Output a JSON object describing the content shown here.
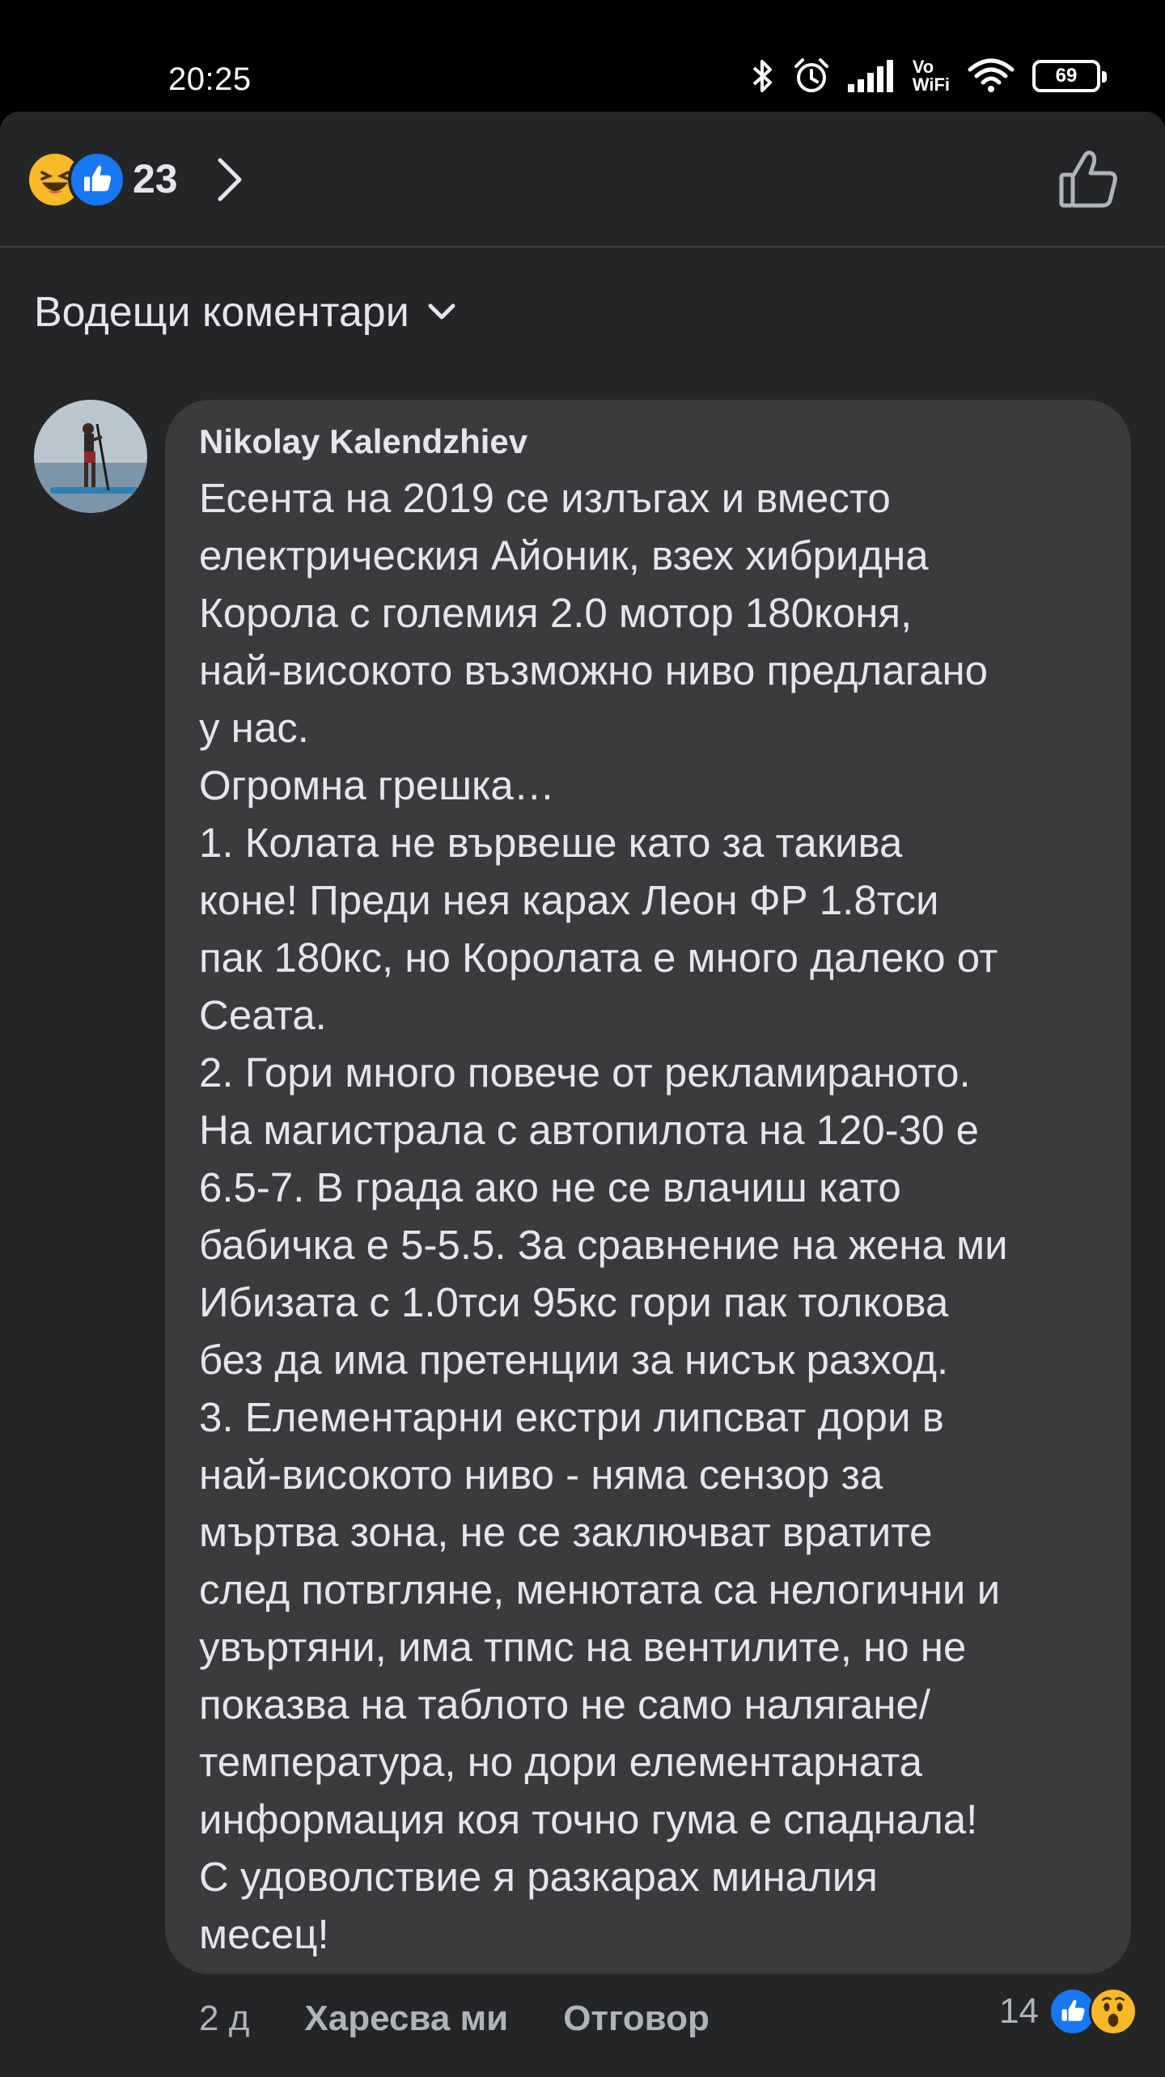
{
  "status_bar": {
    "time": "20:25",
    "network_top": "Vo",
    "network_bottom": "WiFi",
    "battery_level": "69",
    "icons": [
      "bluetooth-icon",
      "alarm-icon",
      "signal-icon",
      "volte-wifi-icon",
      "wifi-icon",
      "battery-icon"
    ]
  },
  "reactions": {
    "icons": [
      "haha-reaction-icon",
      "like-reaction-icon"
    ],
    "count": "23"
  },
  "filter": {
    "label": "Водещи коментари"
  },
  "comment": {
    "author": "Nikolay Kalendzhiev",
    "body": "Есента на 2019 се излъгах и вместо\nелектрическия Айоник, взех хибридна\nКорола с големия 2.0 мотор 180коня,\nнай-високото възможно ниво предлагано\nу нас.\nОгромна грешка…\n1. Колата не вървеше като за такива\nконе! Преди нея карах Леон ФР 1.8тси\nпак 180кс, но Королата е много далеко от\nСеата.\n2. Гори много повече от рекламираното.\nНа магистрала с автопилота на 120-30 е\n6.5-7. В града ако не се влачиш като\nбабичка е 5-5.5. За сравнение на жена ми\nИбизата с 1.0тси 95кс гори пак толкова\nбез да има претенции за нисък разход.\n3. Елементарни екстри липсват дори в\nнай-високото ниво - няма сензор за\nмъртва зона, не се заключват вратите\nслед потвгляне, менютата са нелогични и\nувъртяни, има тпмс на вентилите, но не\nпоказва на таблото не само налягане/\nтемпература, но дори елементарната\nинформация коя точно гума е спаднала!\nС удоволствие я разкарах миналия\nмесец!",
    "age": "2 д",
    "like_label": "Харесва ми",
    "reply_label": "Отговор",
    "reaction_count": "14",
    "reaction_icons": [
      "like-reaction-icon",
      "wow-reaction-icon"
    ]
  },
  "colors": {
    "sheet_bg": "#242526",
    "bubble_bg": "#3a3b3c",
    "text_primary": "#e4e6eb",
    "text_secondary": "#b0b3b8",
    "like_blue": "#1877f2",
    "reaction_yellow": "#f7b928"
  }
}
